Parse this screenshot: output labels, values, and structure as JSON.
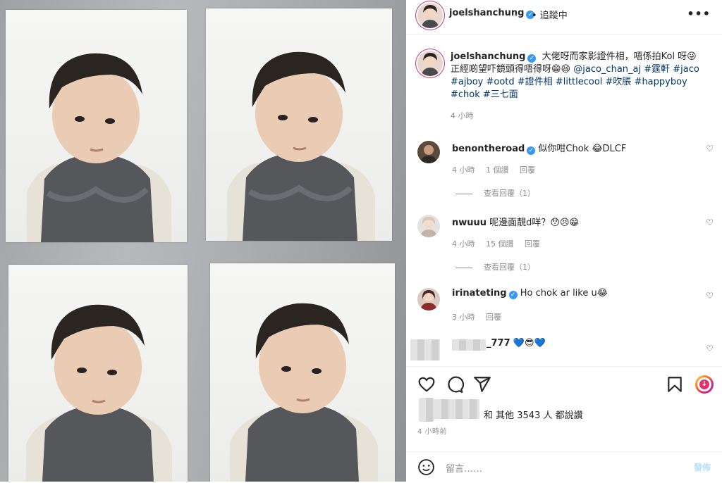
{
  "post": {
    "username": "joelshanchung",
    "follow_status": "• 追蹤中",
    "more_label": "•••",
    "caption": {
      "text": "大佬呀而家影證件相，唔係拍Kol 呀😜 正經啲望吓鏡頭得唔得呀😁😆",
      "mention": "@jaco_chan_aj",
      "hashtags": "#霆軒 #jaco #ajboy #ootd #證件相 #littlecool #吹脹 #happyboy #chok #三七面",
      "time": "4 小時"
    },
    "comments": [
      {
        "username": "benontheroad",
        "verified": true,
        "text": "似你咁Chok 😂DLCF",
        "time": "4 小時",
        "likes": "1 個讚",
        "reply": "回覆",
        "view_replies": "查看回覆（1）"
      },
      {
        "username": "nwuuu",
        "verified": false,
        "text": "呢邊面靚d咩？😯😣😁",
        "time": "4 小時",
        "likes": "15 個讚",
        "reply": "回覆",
        "view_replies": "查看回覆（1）"
      },
      {
        "username": "irinateting",
        "verified": true,
        "text": "Ho chok ar like u😂",
        "time": "3 小時",
        "reply": "回覆"
      },
      {
        "username": "_777",
        "verified": false,
        "text": "💙😎💙"
      }
    ],
    "likes_text": "和 其他 3543 人 都說讚",
    "posted_time": "4 小時前",
    "add_comment_placeholder": "留言……",
    "post_button": "發佈"
  },
  "icons": {
    "like": "heart-icon",
    "comment": "comment-icon",
    "share": "share-icon",
    "save": "bookmark-icon",
    "emoji": "emoji-icon",
    "more": "more-icon"
  },
  "colors": {
    "link": "#00376b",
    "verified": "#3897f0",
    "muted": "#8e8e8e",
    "post_disabled": "#b2dffc"
  }
}
